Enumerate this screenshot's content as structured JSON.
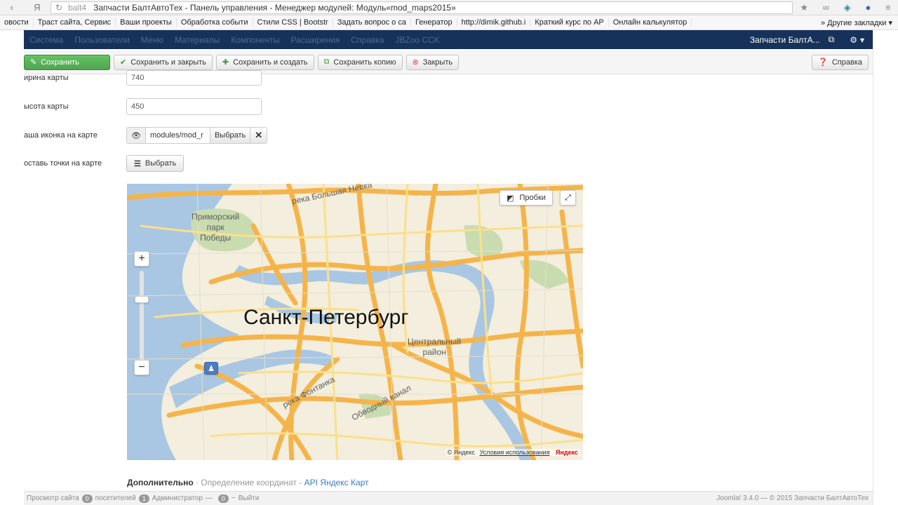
{
  "browser": {
    "nav_icons": [
      "back-icon",
      "yandex-icon"
    ],
    "host": "balt4",
    "title": "Запчасти БалтАвтоТех - Панель управления - Менеджер модулей: Модуль«mod_maps2015»",
    "bookmarks": [
      "овости",
      "Траст сайта, Сервис",
      "Ваши проекты",
      "Обработка событи",
      "Стили CSS | Bootstr",
      "Задать вопрос о са",
      "Генератор",
      "http://dimik.github.i",
      "Краткий курс по АР",
      "Онлайн калькулятор"
    ],
    "more_bookmarks": "Другие закладки"
  },
  "navbar": {
    "items": [
      "Система",
      "Пользователи",
      "Меню",
      "Материалы",
      "Компоненты",
      "Расширения",
      "Справка",
      "JBZoo CCK"
    ],
    "site": "Запчасти БалтА..."
  },
  "toolbar": {
    "save": "Сохранить",
    "save_close": "Сохранить и закрыть",
    "save_new": "Сохранить и создать",
    "save_copy": "Сохранить копию",
    "close": "Закрыть",
    "help": "Справка"
  },
  "form": {
    "width_label": "ирина карты",
    "width_value": "740",
    "height_label": "ысота карты",
    "height_value": "450",
    "icon_label": "аша иконка на карте",
    "icon_path": "modules/mod_r",
    "icon_select": "Выбрать",
    "points_label": "оставь точки на карте",
    "points_select": "Выбрать"
  },
  "map": {
    "city": "Санкт-Петербург",
    "labels": {
      "park": "Приморский\nпарк\nПобеды",
      "river_nevka": "река Большая Невка",
      "district": "Центральный\nрайон",
      "fontanka": "река Фонтанка",
      "canal": "Обводный канал"
    },
    "traffic": "Пробки",
    "copyright": "© Яндекс",
    "terms": "Условия использования",
    "brand": "Яндекс"
  },
  "extra": {
    "label": "Дополнительно",
    "separator1": " · ",
    "coords": "Определение координат",
    "separator2": " - ",
    "api": "API Яндекс Карт"
  },
  "status": {
    "view_site": "Просмотр сайта",
    "visitors_count": "0",
    "visitors": "посетителей",
    "admins_count": "1",
    "admins": "Администратор",
    "messages_count": "0",
    "logout": "Выйти",
    "version": "Joomla! 3.4.0 — © 2015 Запчасти БалтАвтоТех"
  }
}
